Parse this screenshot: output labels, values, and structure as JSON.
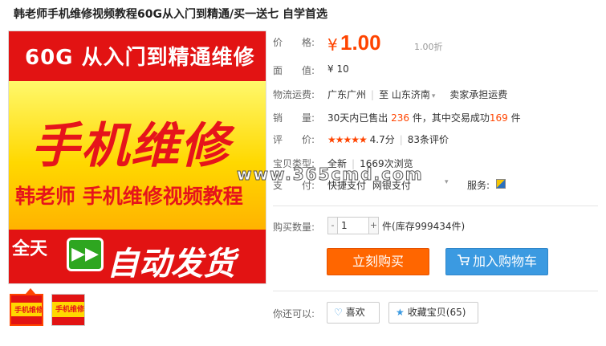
{
  "title": "韩老师手机维修视频教程60G从入门到精通/买一送七 自学首选",
  "gallery": {
    "top_text": "60G 从入门到精通维修",
    "big_text": "手机维修",
    "sub_text": "韩老师 手机维修视频教程",
    "allday_text": "全天",
    "play_symbol": "▶▶",
    "auto_text": "自动发货",
    "watermark": "www.365cmd.com",
    "thumbs": [
      {
        "label": "手机维修"
      },
      {
        "label": "手机维修"
      }
    ]
  },
  "price": {
    "label": "价　　格:",
    "currency": "¥",
    "value": "1.00",
    "discount": "1.00折"
  },
  "face_value": {
    "label": "面　　值:",
    "value": "¥ 10"
  },
  "shipping": {
    "label": "物流运费:",
    "from": "广东广州",
    "to_label": "至",
    "to": "山东济南",
    "note": "卖家承担运费"
  },
  "sales": {
    "label": "销　　量:",
    "prefix": "30天内已售出",
    "count": "236",
    "mid": "件，其中交易成功",
    "success": "169",
    "suffix": "件"
  },
  "rating": {
    "label": "评　　价:",
    "stars": "★★★★★",
    "score": "4.7分",
    "reviews": "83条评价"
  },
  "item_type": {
    "label": "宝贝类型:",
    "value": "全新",
    "views": "1669次浏览"
  },
  "payment": {
    "label": "支　　付:",
    "method1": "快捷支付",
    "method2": "网银支付",
    "service_label": "服务:"
  },
  "quantity": {
    "label": "购买数量:",
    "minus": "-",
    "value": "1",
    "plus": "+",
    "unit": "件",
    "stock": "(库存999434件)"
  },
  "actions": {
    "buy_now": "立刻购买",
    "add_cart": "加入购物车",
    "also_label": "你还可以:",
    "like": "喜欢",
    "favorite": "收藏宝贝(65)"
  },
  "colors": {
    "accent": "#ff4400",
    "buy": "#ff6600",
    "cart": "#3b9ae1"
  }
}
